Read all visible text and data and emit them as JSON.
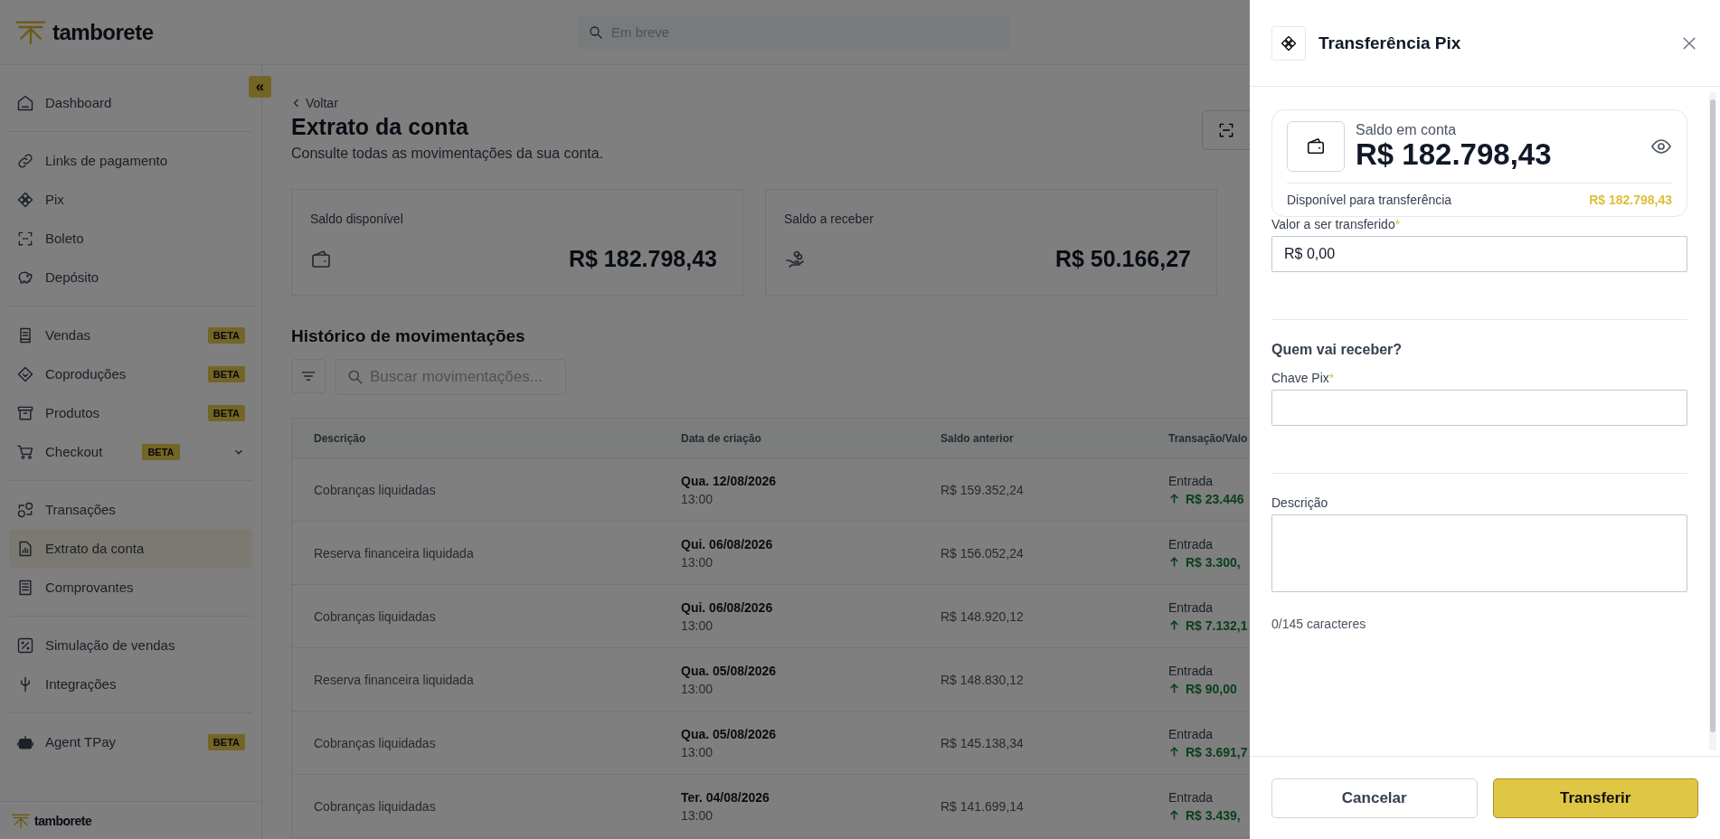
{
  "app": {
    "logo": "tamborete",
    "search": {
      "placeholder": "Em breve"
    },
    "collapse_button": "«",
    "footer_logo": "tamborete"
  },
  "sidebar": {
    "groups": [
      [
        {
          "label": "Dashboard",
          "selected": false
        }
      ],
      [
        {
          "label": "Links de pagamento",
          "selected": false
        },
        {
          "label": "Pix",
          "selected": false
        },
        {
          "label": "Boleto",
          "selected": false
        },
        {
          "label": "Depósito",
          "selected": false
        }
      ],
      [
        {
          "label": "Vendas",
          "badge": "BETA",
          "selected": false
        },
        {
          "label": "Coproduções",
          "badge": "BETA",
          "selected": false
        },
        {
          "label": "Produtos",
          "badge": "BETA",
          "selected": false
        },
        {
          "label": "Checkout",
          "badge": "BETA",
          "selected": false,
          "expanded": false
        }
      ],
      [
        {
          "label": "Transações",
          "selected": false
        },
        {
          "label": "Extrato da conta",
          "selected": true
        },
        {
          "label": "Comprovantes",
          "selected": false
        }
      ],
      [
        {
          "label": "Simulação de vendas",
          "selected": false
        },
        {
          "label": "Integrações",
          "selected": false
        }
      ],
      [
        {
          "label": "Agent TPay",
          "badge": "BETA",
          "selected": false
        }
      ]
    ]
  },
  "page": {
    "back_link": "Voltar",
    "title": "Extrato da conta",
    "subtitle": "Consulte todas as movimentações da sua conta.",
    "cards": [
      {
        "label": "Saldo disponível",
        "value": "R$ 182.798,43"
      },
      {
        "label": "Saldo a receber",
        "value": "R$ 50.166,27"
      }
    ],
    "section_title": "Histórico de movimentações",
    "search": {
      "placeholder": "Buscar movimentações..."
    },
    "table": {
      "columns": [
        "Descrição",
        "Data de criação",
        "Saldo anterior",
        "Transação/Valo"
      ],
      "rows": [
        {
          "description": "Cobranças liquidadas",
          "date": "Qua. 12/08/2026",
          "time": "13:00",
          "previous_balance": "R$ 159.352,24",
          "type": "Entrada",
          "amount": "R$ 23.446"
        },
        {
          "description": "Reserva financeira liquidada",
          "date": "Qui. 06/08/2026",
          "time": "13:00",
          "previous_balance": "R$ 156.052,24",
          "type": "Entrada",
          "amount": "R$ 3.300,"
        },
        {
          "description": "Cobranças liquidadas",
          "date": "Qui. 06/08/2026",
          "time": "13:00",
          "previous_balance": "R$ 148.920,12",
          "type": "Entrada",
          "amount": "R$ 7.132,1"
        },
        {
          "description": "Reserva financeira liquidada",
          "date": "Qua. 05/08/2026",
          "time": "13:00",
          "previous_balance": "R$ 148.830,12",
          "type": "Entrada",
          "amount": "R$ 90,00"
        },
        {
          "description": "Cobranças liquidadas",
          "date": "Qua. 05/08/2026",
          "time": "13:00",
          "previous_balance": "R$ 145.138,34",
          "type": "Entrada",
          "amount": "R$ 3.691,7"
        },
        {
          "description": "Cobranças liquidadas",
          "date": "Ter. 04/08/2026",
          "time": "13:00",
          "previous_balance": "R$ 141.699,14",
          "type": "Entrada",
          "amount": "R$ 3.439,"
        }
      ]
    }
  },
  "drawer": {
    "title": "Transferência Pix",
    "balance": {
      "label": "Saldo em conta",
      "value": "R$ 182.798,43",
      "available_label": "Disponível para transferência",
      "available_value": "R$ 182.798,43"
    },
    "sections": [
      {
        "fields": [
          {
            "kind": "input",
            "label": "Valor a ser transferido",
            "required_mark": "*",
            "value": "R$ 0,00"
          }
        ]
      },
      {
        "heading": "Quem vai receber?",
        "fields": [
          {
            "kind": "input",
            "label": "Chave Pix",
            "required_mark": "*"
          }
        ]
      },
      {
        "fields": [
          {
            "kind": "textarea",
            "label": "Descrição"
          }
        ],
        "counter": "0/145 caracteres"
      }
    ],
    "buttons": [
      {
        "kind": "secondary",
        "label": "Cancelar"
      },
      {
        "kind": "primary",
        "label": "Transferir"
      }
    ]
  }
}
